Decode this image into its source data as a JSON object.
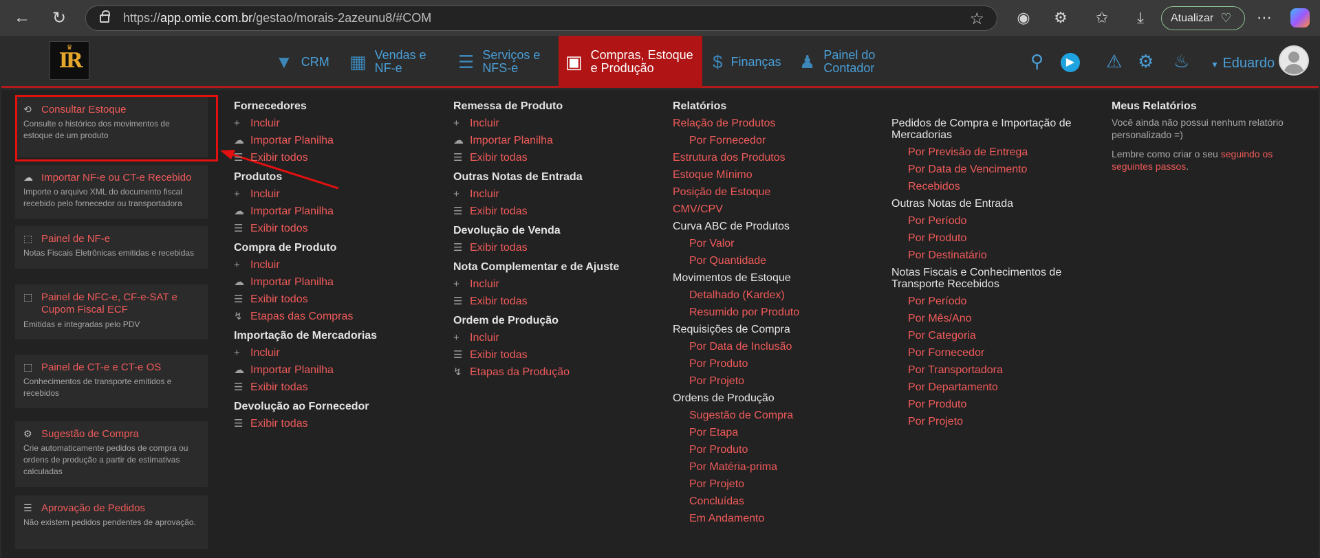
{
  "browser": {
    "url_prefix": "https://",
    "url_host": "app.omie.com.br",
    "url_path": "/gestao/morais-2azeunu8/#COM",
    "update_label": "Atualizar"
  },
  "header": {
    "menu": [
      {
        "label": "CRM",
        "icon": "funnel-icon"
      },
      {
        "label": "Vendas e NF-e",
        "icon": "bar-chart-icon"
      },
      {
        "label": "Serviços e NFS-e",
        "icon": "checklist-icon"
      },
      {
        "label": "Compras, Estoque e Produção",
        "icon": "box-icon"
      },
      {
        "label": "Finanças",
        "icon": "dollar-icon"
      },
      {
        "label": "Painel do Contador",
        "icon": "user-icon"
      }
    ],
    "user": "Eduardo",
    "active_color": "#b01414"
  },
  "cards": [
    {
      "title": "Consultar Estoque",
      "icon": "history-icon",
      "desc": "Consulte o histórico dos movimentos de estoque de um produto"
    },
    {
      "title": "Importar NF-e ou CT-e Recebido",
      "icon": "cloud-upload-icon",
      "desc": "Importe o arquivo XML do documento fiscal recebido pelo fornecedor ou transportadora"
    },
    {
      "title": "Painel de NF-e",
      "icon": "frame-icon",
      "desc": "Notas Fiscais Eletrônicas emitidas e recebidas"
    },
    {
      "title": "Painel de NFC-e, CF-e-SAT e Cupom Fiscal ECF",
      "icon": "frame-icon",
      "desc": "Emitidas e integradas pelo PDV"
    },
    {
      "title": "Painel de CT-e e CT-e OS",
      "icon": "frame-icon",
      "desc": "Conhecimentos de transporte emitidos e recebidos"
    },
    {
      "title": "Sugestão de Compra",
      "icon": "robot-icon",
      "desc": "Crie automaticamente pedidos de compra ou ordens de produção a partir de estimativas calculadas"
    },
    {
      "title": "Aprovação de Pedidos",
      "icon": "checklist-icon",
      "desc": "Não existem pedidos pendentes de aprovação."
    }
  ],
  "col1": {
    "fornecedores": {
      "title": "Fornecedores",
      "incluir": "Incluir",
      "importar": "Importar Planilha",
      "exibir": "Exibir todos"
    },
    "produtos": {
      "title": "Produtos",
      "incluir": "Incluir",
      "importar": "Importar Planilha",
      "exibir": "Exibir todos"
    },
    "compra": {
      "title": "Compra de Produto",
      "incluir": "Incluir",
      "importar": "Importar Planilha",
      "exibir": "Exibir todos",
      "etapas": "Etapas das Compras"
    },
    "importacao": {
      "title": "Importação de Mercadorias",
      "incluir": "Incluir",
      "importar": "Importar Planilha",
      "exibir": "Exibir todas"
    },
    "devolucao": {
      "title": "Devolução ao Fornecedor",
      "exibir": "Exibir todas"
    }
  },
  "col2": {
    "remessa": {
      "title": "Remessa de Produto",
      "incluir": "Incluir",
      "importar": "Importar Planilha",
      "exibir": "Exibir todas"
    },
    "outras": {
      "title": "Outras Notas de Entrada",
      "incluir": "Incluir",
      "exibir": "Exibir todas"
    },
    "devvenda": {
      "title": "Devolução de Venda",
      "exibir": "Exibir todas"
    },
    "complementar": {
      "title": "Nota Complementar e de Ajuste",
      "incluir": "Incluir",
      "exibir": "Exibir todas"
    },
    "ordem": {
      "title": "Ordem de Produção",
      "incluir": "Incluir",
      "exibir": "Exibir todas",
      "etapas": "Etapas da Produção"
    }
  },
  "col3": {
    "title": "Relatórios",
    "items": [
      {
        "type": "link",
        "label": "Relação de Produtos"
      },
      {
        "type": "sub",
        "label": "Por Fornecedor"
      },
      {
        "type": "link",
        "label": "Estrutura dos Produtos"
      },
      {
        "type": "link",
        "label": "Estoque Mínimo"
      },
      {
        "type": "link",
        "label": "Posição de Estoque"
      },
      {
        "type": "link",
        "label": "CMV/CPV"
      },
      {
        "type": "head",
        "label": "Curva ABC de Produtos"
      },
      {
        "type": "sub",
        "label": "Por Valor"
      },
      {
        "type": "sub",
        "label": "Por Quantidade"
      },
      {
        "type": "head",
        "label": "Movimentos de Estoque"
      },
      {
        "type": "sub",
        "label": "Detalhado (Kardex)"
      },
      {
        "type": "sub",
        "label": "Resumido por Produto"
      },
      {
        "type": "head",
        "label": "Requisições de Compra"
      },
      {
        "type": "sub",
        "label": "Por Data de Inclusão"
      },
      {
        "type": "sub",
        "label": "Por Produto"
      },
      {
        "type": "sub",
        "label": "Por Projeto"
      },
      {
        "type": "head",
        "label": "Ordens de Produção"
      },
      {
        "type": "sub",
        "label": "Sugestão de Compra"
      },
      {
        "type": "sub",
        "label": "Por Etapa"
      },
      {
        "type": "sub",
        "label": "Por Produto"
      },
      {
        "type": "sub",
        "label": "Por Matéria-prima"
      },
      {
        "type": "sub",
        "label": "Por Projeto"
      },
      {
        "type": "sub",
        "label": "Concluídas"
      },
      {
        "type": "sub",
        "label": "Em Andamento"
      }
    ]
  },
  "col4": {
    "items": [
      {
        "type": "head",
        "label": "Pedidos de Compra e Importação de Mercadorias"
      },
      {
        "type": "sub",
        "label": "Por Previsão de Entrega"
      },
      {
        "type": "sub",
        "label": "Por Data de Vencimento"
      },
      {
        "type": "sub",
        "label": "Recebidos"
      },
      {
        "type": "head",
        "label": "Outras Notas de Entrada"
      },
      {
        "type": "sub",
        "label": "Por Período"
      },
      {
        "type": "sub",
        "label": "Por Produto"
      },
      {
        "type": "sub",
        "label": "Por Destinatário"
      },
      {
        "type": "head",
        "label": "Notas Fiscais e Conhecimentos de Transporte Recebidos"
      },
      {
        "type": "sub",
        "label": "Por Período"
      },
      {
        "type": "sub",
        "label": "Por Mês/Ano"
      },
      {
        "type": "sub",
        "label": "Por Categoria"
      },
      {
        "type": "sub",
        "label": "Por Fornecedor"
      },
      {
        "type": "sub",
        "label": "Por Transportadora"
      },
      {
        "type": "sub",
        "label": "Por Departamento"
      },
      {
        "type": "sub",
        "label": "Por Produto"
      },
      {
        "type": "sub",
        "label": "Por Projeto"
      }
    ]
  },
  "col5": {
    "title": "Meus Relatórios",
    "note1": "Você ainda não possui nenhum relatório personalizado =)",
    "note2_prefix": "Lembre como criar o seu ",
    "note2_link": "seguindo os seguintes passos",
    "note2_suffix": "."
  }
}
